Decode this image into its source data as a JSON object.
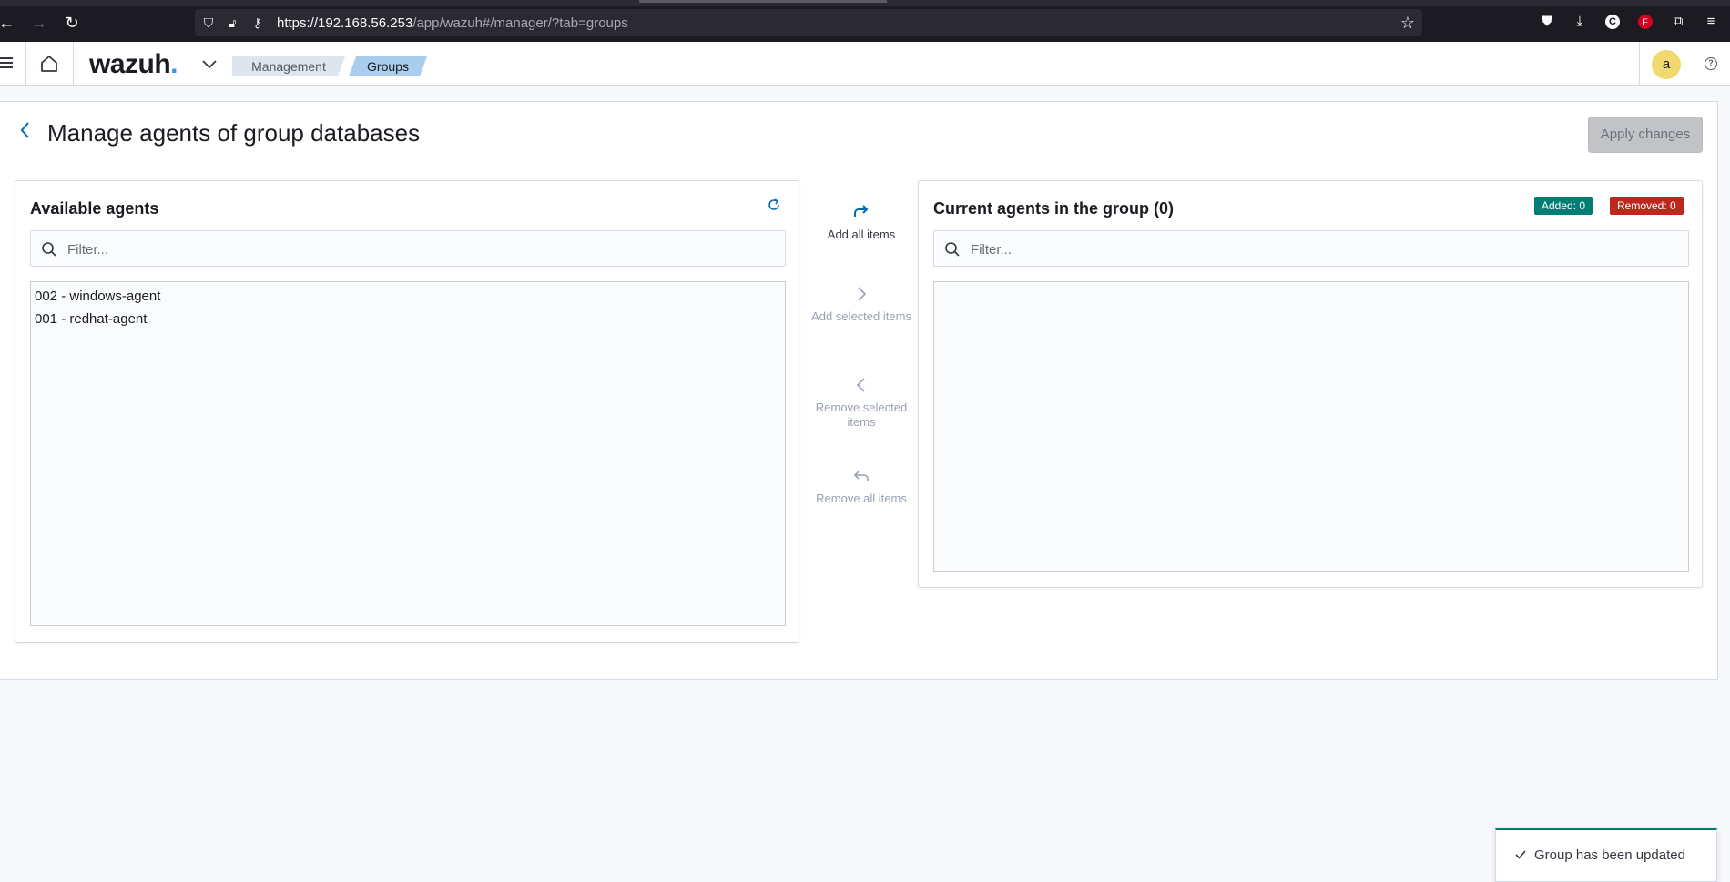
{
  "browser": {
    "url_host": "https://192.168.56.253",
    "url_path": "/app/wazuh#/manager/?tab=groups"
  },
  "header": {
    "logo_text": "wazuh",
    "logo_dot": ".",
    "breadcrumb": [
      "Management",
      "Groups"
    ],
    "avatar_initial": "a",
    "help_glyph": "?"
  },
  "page": {
    "title": "Manage agents of group databases",
    "apply_label": "Apply changes"
  },
  "available": {
    "title": "Available agents",
    "filter_placeholder": "Filter...",
    "agents": [
      "002 - windows-agent",
      "001 - redhat-agent"
    ]
  },
  "current": {
    "title": "Current agents in the group (0)",
    "filter_placeholder": "Filter...",
    "added_badge": "Added: 0",
    "removed_badge": "Removed: 0",
    "agents": []
  },
  "transfer": {
    "add_all": "Add all items",
    "add_selected": "Add selected items",
    "remove_selected": "Remove selected items",
    "remove_all": "Remove all items"
  },
  "toast": {
    "message": "Group has been updated"
  },
  "colors": {
    "accent": "#006bb4",
    "added": "#017d73",
    "removed": "#bd271e",
    "breadcrumb_active": "#a9cdec"
  },
  "icons": [
    "back-icon",
    "forward-icon",
    "reload-icon",
    "shield-icon",
    "lock-icon",
    "key-icon",
    "star-icon",
    "pocket-icon",
    "download-icon",
    "extension-icon",
    "menu-icon",
    "home-icon",
    "chevron-down-icon",
    "refresh-icon",
    "search-icon",
    "share-icon",
    "chevron-right-icon",
    "chevron-left-icon",
    "undo-icon",
    "check-icon"
  ]
}
